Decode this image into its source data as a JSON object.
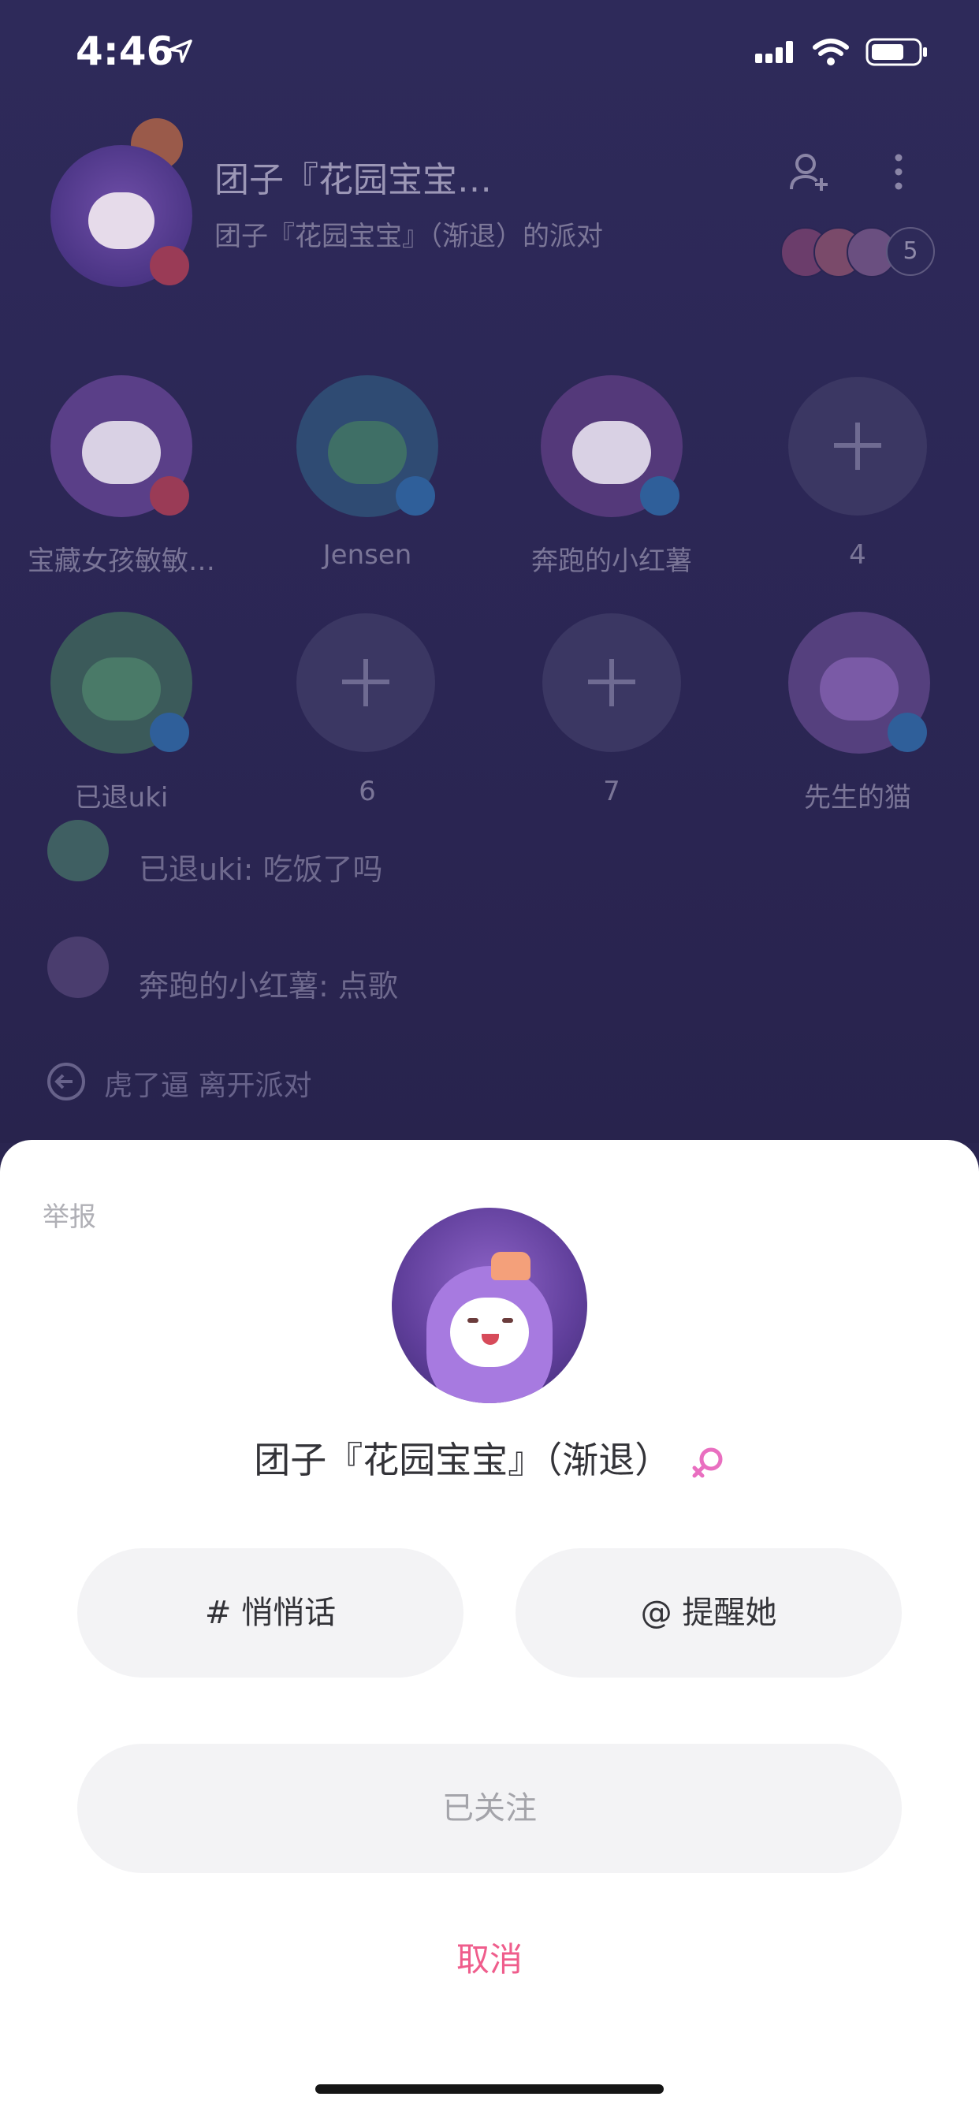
{
  "status_bar": {
    "time": "4:46"
  },
  "room": {
    "title": "团子『花园宝宝…",
    "subtitle": "团子『花园宝宝』（渐退）的派对",
    "audience_count": "5"
  },
  "seats": [
    {
      "name": "宝藏女孩敏敏…",
      "type": "user"
    },
    {
      "name": "Jensen",
      "type": "user"
    },
    {
      "name": "奔跑的小红薯",
      "type": "user"
    },
    {
      "name": "4",
      "type": "empty"
    },
    {
      "name": "已退uki",
      "type": "user"
    },
    {
      "name": "6",
      "type": "empty"
    },
    {
      "name": "7",
      "type": "empty"
    },
    {
      "name": "先生的猫",
      "type": "user"
    }
  ],
  "chat": [
    {
      "text": "已退uki: 吃饭了吗"
    },
    {
      "text": "奔跑的小红薯: 点歌"
    }
  ],
  "leave_notice": "虎了逼 离开派对",
  "sheet": {
    "report": "举报",
    "user_name": "团子『花园宝宝』（渐退）",
    "whisper_label": "# 悄悄话",
    "mention_label": "@ 提醒她",
    "follow_label": "已关注",
    "cancel_label": "取消"
  },
  "colors": {
    "accent": "#ef5d8c",
    "gender_female": "#e96fc0"
  }
}
